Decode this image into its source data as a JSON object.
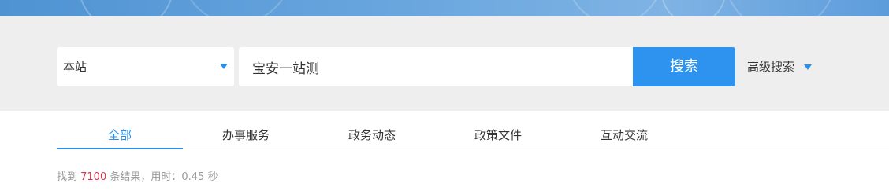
{
  "search": {
    "scope_selected": "本站",
    "query_value": "宝安一站测",
    "button_label": "搜索",
    "advanced_label": "高级搜索"
  },
  "tabs": [
    {
      "label": "全部",
      "active": true
    },
    {
      "label": "办事服务",
      "active": false
    },
    {
      "label": "政务动态",
      "active": false
    },
    {
      "label": "政策文件",
      "active": false
    },
    {
      "label": "互动交流",
      "active": false
    }
  ],
  "results": {
    "prefix": "找到 ",
    "count": "7100",
    "middle": " 条结果，用时：",
    "time": "0.45",
    "suffix": " 秒"
  },
  "colors": {
    "accent": "#2b8fe6",
    "button": "#2d93ee",
    "count": "#e0304a",
    "band": "#eeeeee"
  },
  "icons": {
    "scope_caret": "caret-down-icon",
    "advanced_caret": "caret-down-icon"
  }
}
